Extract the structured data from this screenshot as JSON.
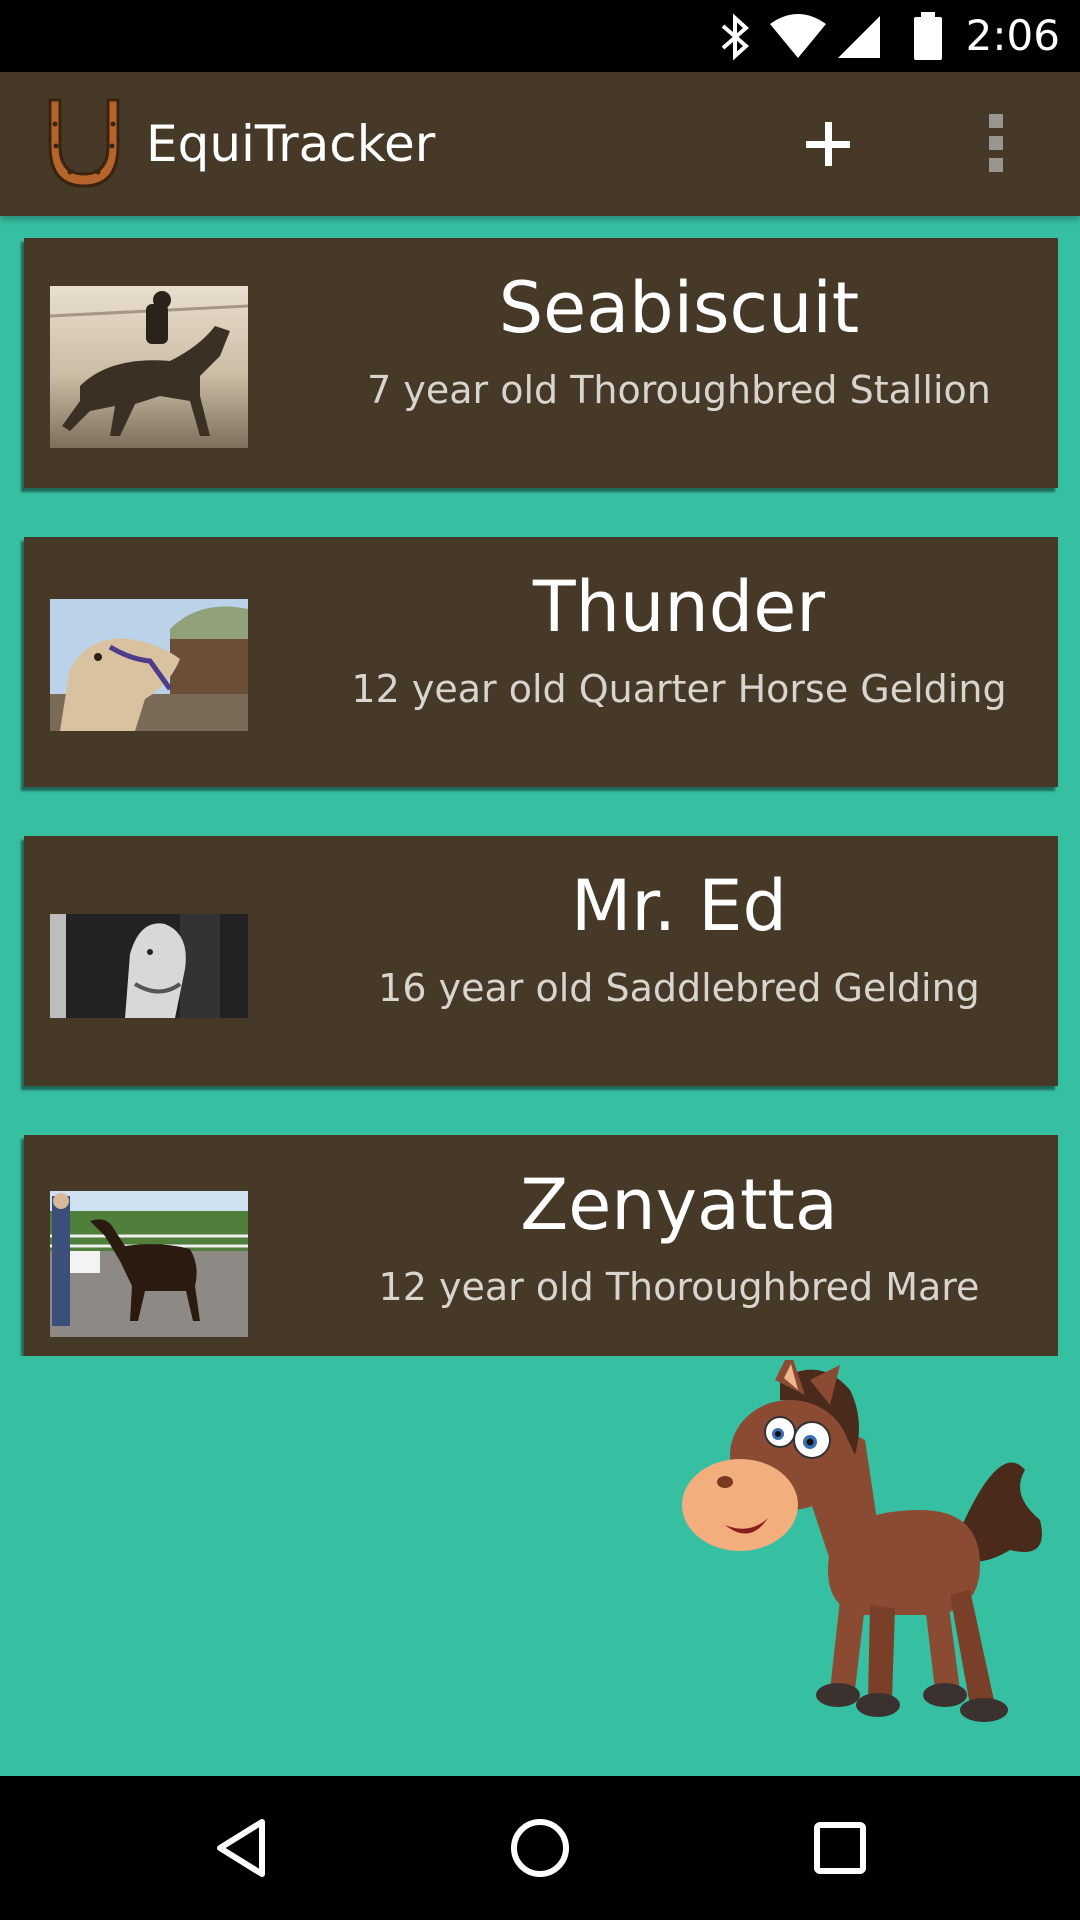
{
  "status_bar": {
    "time": "2:06",
    "icons": [
      "bluetooth-icon",
      "wifi-icon",
      "cell-signal-icon",
      "battery-icon"
    ]
  },
  "app_bar": {
    "title": "EquiTracker",
    "logo_icon": "horseshoe-icon",
    "actions": [
      "add-icon",
      "overflow-menu-icon"
    ]
  },
  "horses": [
    {
      "name": "Seabiscuit",
      "description": "7 year old Thoroughbred Stallion"
    },
    {
      "name": "Thunder",
      "description": "12 year old Quarter Horse Gelding"
    },
    {
      "name": "Mr. Ed",
      "description": "16 year old Saddlebred Gelding"
    },
    {
      "name": "Zenyatta",
      "description": "12 year old Thoroughbred Mare"
    }
  ],
  "nav_bar": {
    "buttons": [
      "back-icon",
      "home-icon",
      "recents-icon"
    ]
  },
  "colors": {
    "background": "#37BFA1",
    "app_bar": "#463927",
    "card": "#463927",
    "accent_horseshoe": "#B5642B"
  }
}
